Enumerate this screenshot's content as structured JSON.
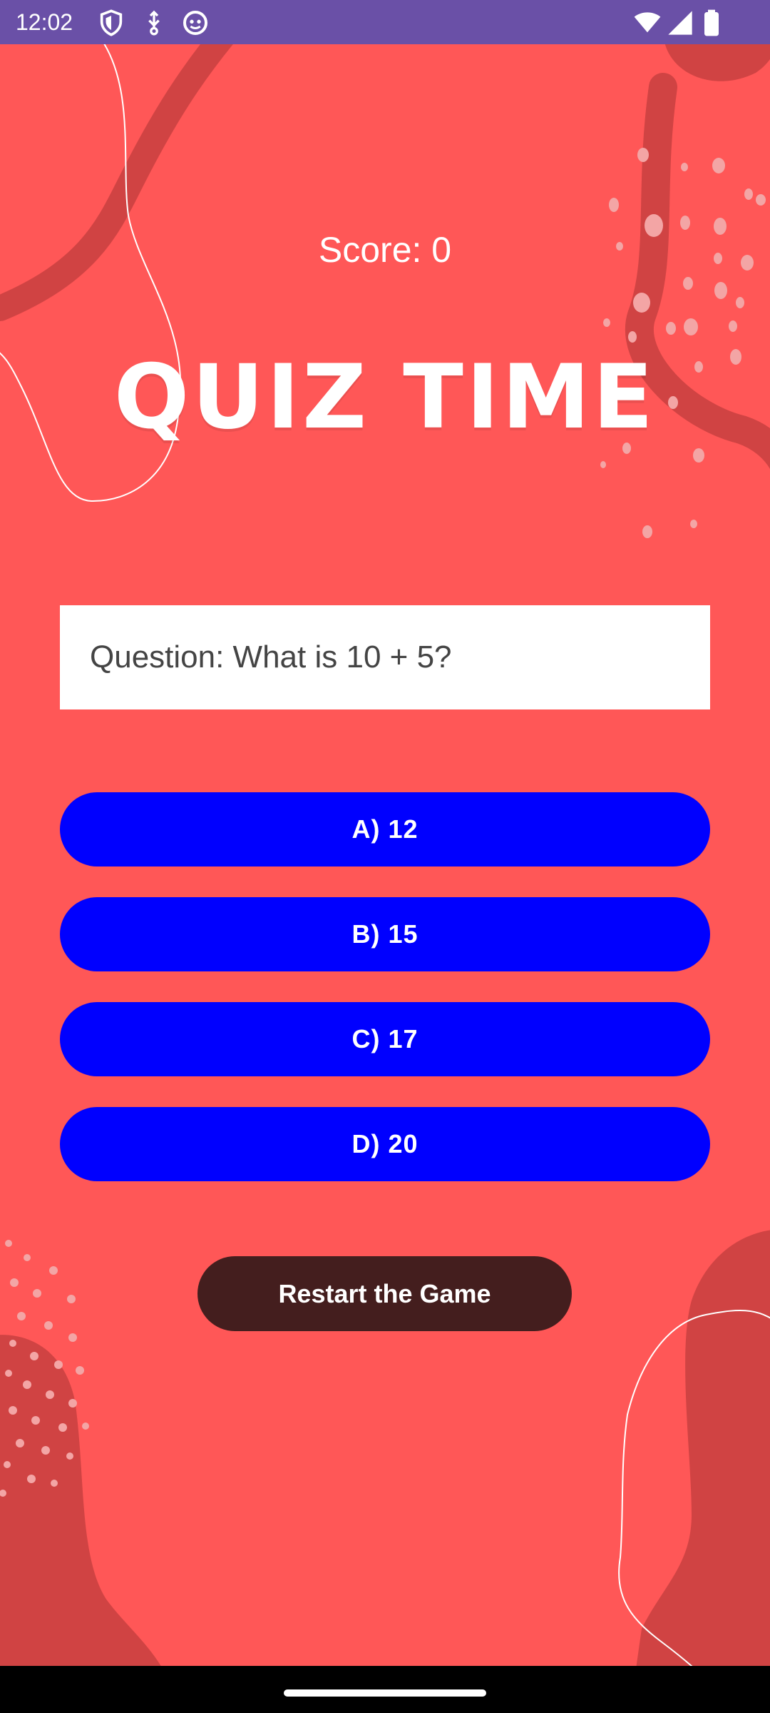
{
  "status_bar": {
    "time": "12:02",
    "icons": [
      "shield-icon",
      "usb-debug-icon",
      "app-notification-icon",
      "wifi-icon",
      "signal-icon",
      "battery-icon"
    ],
    "background": "#6a50a7"
  },
  "quiz": {
    "score_label": "Score: 0",
    "title": "QUIZ TIME",
    "question": "Question: What is 10 + 5?",
    "answers": [
      "A) 12",
      "B) 15",
      "C) 17",
      "D) 20"
    ],
    "restart_label": "Restart the Game"
  },
  "colors": {
    "background": "#ff5757",
    "answer_button": "#0000ff",
    "restart_button": "#441e1e",
    "decor_shape": "#d04343",
    "nav_bar": "#000000"
  }
}
